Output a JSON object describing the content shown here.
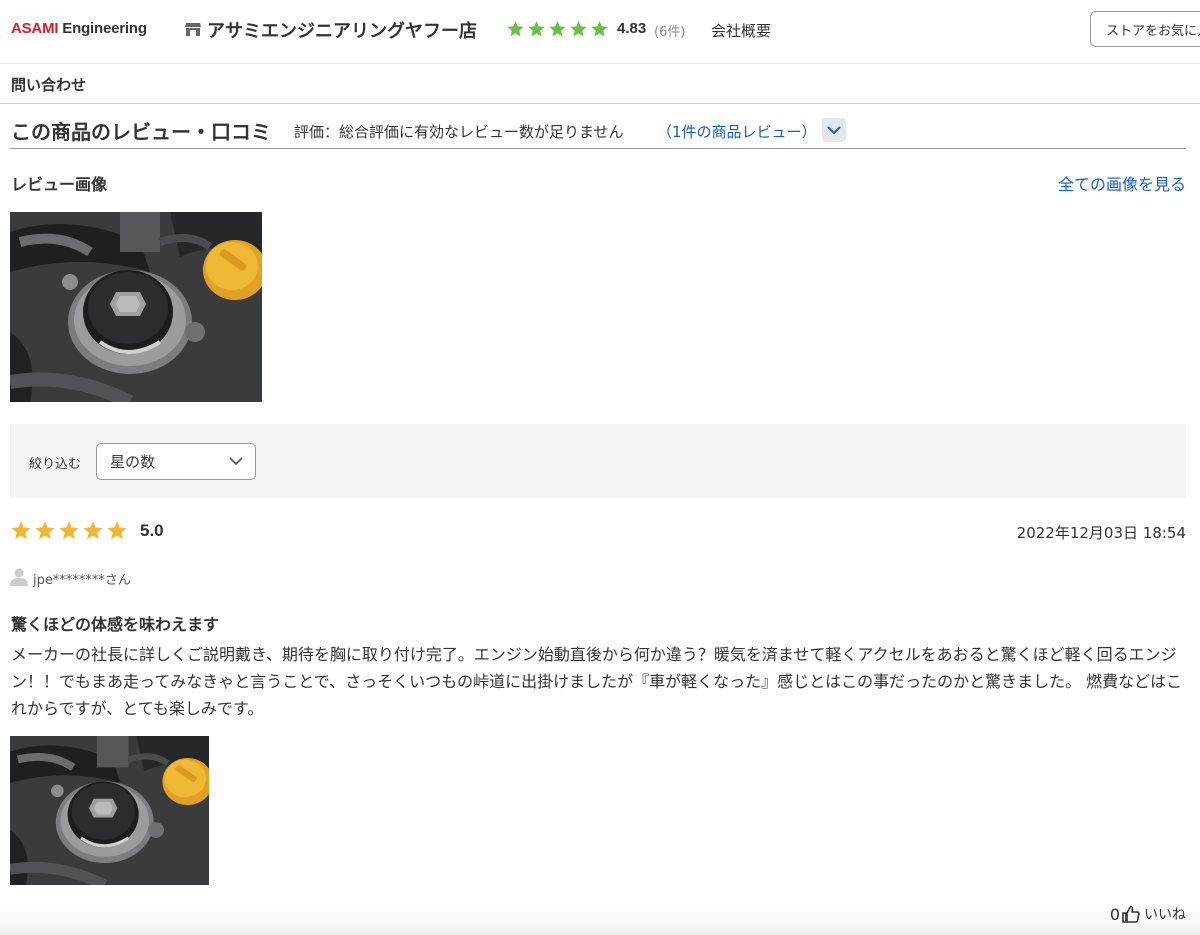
{
  "header": {
    "logo_brand": "ASAMI",
    "logo_rest": " Engineering",
    "store_name": "アサミエンジニアリングヤフー店",
    "rating": 4.83,
    "rating_text": "4.83",
    "rating_count": "(6件)",
    "company_link": "会社概要",
    "favorite_button": "ストアをお気に入り",
    "star_color": "#6cbe45"
  },
  "subheader": {
    "inquiry": "問い合わせ"
  },
  "reviews_section": {
    "title": "この商品のレビュー・口コミ",
    "evaluation": "評価：総合評価に有効なレビュー数が足りません",
    "review_count_link": "（1件の商品レビュー）",
    "images_title": "レビュー画像",
    "all_images_link": "全ての画像を見る"
  },
  "filter": {
    "label": "絞り込む",
    "select_value": "星の数"
  },
  "review": {
    "stars": 5,
    "score": "5.0",
    "star_color": "#f5b731",
    "date": "2022年12月03日 18:54",
    "user": "jpe********さん",
    "title": "驚くほどの体感を味わえます",
    "body": "メーカーの社長に詳しくご説明戴き、期待を胸に取り付け完了。エンジン始動直後から何か違う？暖気を済ませて軽くアクセルをあおると驚くほど軽く回るエンジン！！でもまあ走ってみなきゃと言うことで、さっそくいつもの峠道に出掛けましたが『車が軽くなった』感じとはこの事だったのかと驚きました。 燃費などはこれからですが、とても楽しみです。",
    "likes": "0",
    "like_label": "いいね"
  },
  "colors": {
    "link": "#1a5bc4",
    "brand_red": "#d61f26",
    "heart": "#e8335a"
  }
}
